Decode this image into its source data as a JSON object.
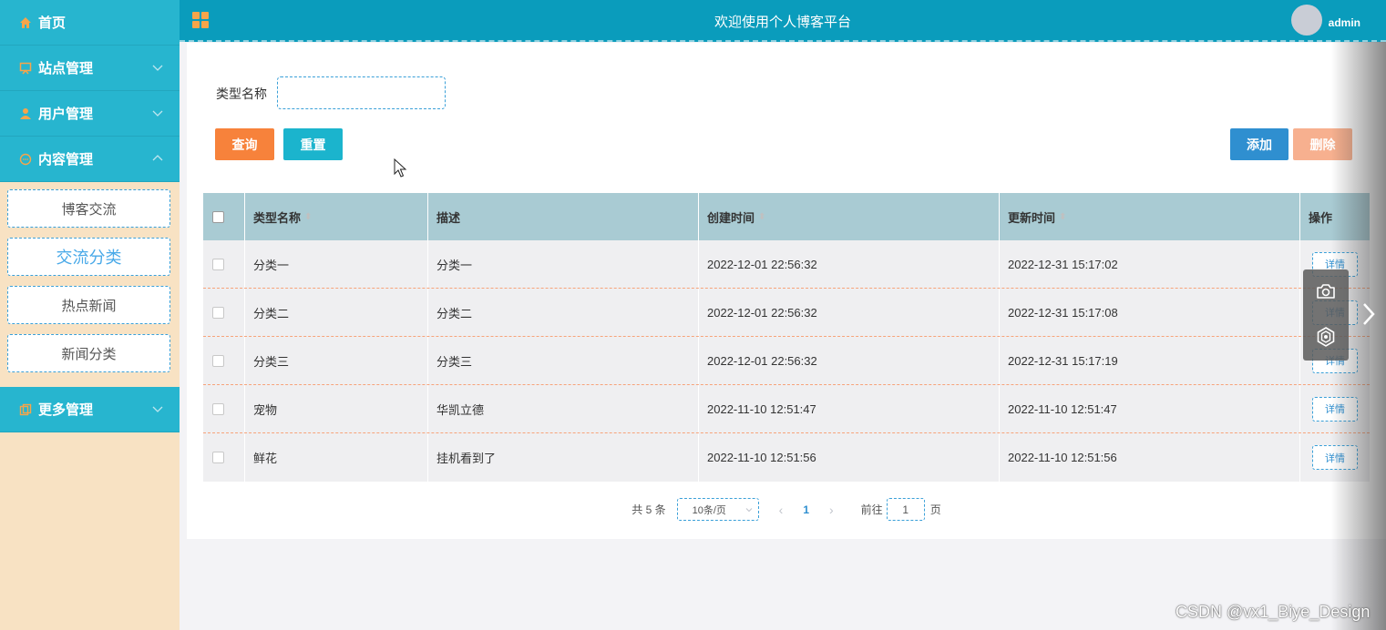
{
  "sidebar": {
    "items": [
      {
        "label": "首页",
        "icon": "home-icon"
      },
      {
        "label": "站点管理",
        "icon": "easel-icon"
      },
      {
        "label": "用户管理",
        "icon": "user-icon"
      },
      {
        "label": "内容管理",
        "icon": "chat-icon"
      },
      {
        "label": "更多管理",
        "icon": "copy-icon"
      }
    ],
    "submenu": [
      "博客交流",
      "交流分类",
      "热点新闻",
      "新闻分类"
    ],
    "active_submenu": "交流分类"
  },
  "header": {
    "title": "欢迎使用个人博客平台",
    "username": "admin"
  },
  "search": {
    "label": "类型名称",
    "value": ""
  },
  "buttons": {
    "query": "查询",
    "reset": "重置",
    "add": "添加",
    "delete": "删除"
  },
  "table": {
    "columns": [
      "类型名称",
      "描述",
      "创建时间",
      "更新时间",
      "操作"
    ],
    "rows": [
      {
        "name": "分类一",
        "desc": "分类一",
        "created": "2022-12-01 22:56:32",
        "updated": "2022-12-31 15:17:02"
      },
      {
        "name": "分类二",
        "desc": "分类二",
        "created": "2022-12-01 22:56:32",
        "updated": "2022-12-31 15:17:08"
      },
      {
        "name": "分类三",
        "desc": "分类三",
        "created": "2022-12-01 22:56:32",
        "updated": "2022-12-31 15:17:19"
      },
      {
        "name": "宠物",
        "desc": "华凯立德",
        "created": "2022-11-10 12:51:47",
        "updated": "2022-11-10 12:51:47"
      },
      {
        "name": "鲜花",
        "desc": "挂机看到了",
        "created": "2022-11-10 12:51:56",
        "updated": "2022-11-10 12:51:56"
      }
    ],
    "detail_label": "详情"
  },
  "pagination": {
    "total": "共 5 条",
    "page_size": "10条/页",
    "current_page": "1",
    "goto_prefix": "前往",
    "goto_value": "1",
    "goto_suffix": "页"
  },
  "watermark": "CSDN @vx1_Biye_Design",
  "colors": {
    "sidebar_bg": "#f8e2c3",
    "menu_bg": "#27b5cf",
    "header_bg": "#0a9cbc",
    "query": "#f7823b",
    "reset": "#1bb4cd",
    "add": "#2f8fd0",
    "delete": "#f7b08f"
  }
}
